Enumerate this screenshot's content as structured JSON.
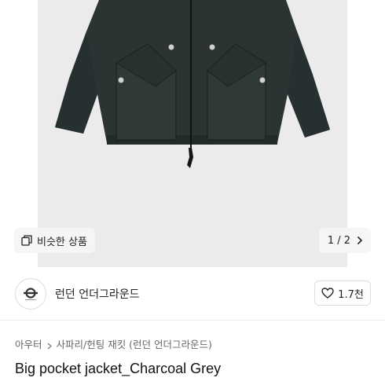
{
  "product_image": {
    "similar_button_label": "비슷한 상품",
    "page_indicator": "1 / 2"
  },
  "seller": {
    "name": "런던 언더그라운드",
    "likes": "1.7천"
  },
  "breadcrumb": {
    "items": [
      "아우터",
      "사파리/헌팅 재킷 (런던 언더그라운드)"
    ]
  },
  "product": {
    "title": "Big pocket jacket_Charcoal Grey"
  },
  "colors": {
    "jacket": "#2b3433",
    "photo_bg": "#ebebeb",
    "text": "#222222",
    "muted": "#666666"
  }
}
